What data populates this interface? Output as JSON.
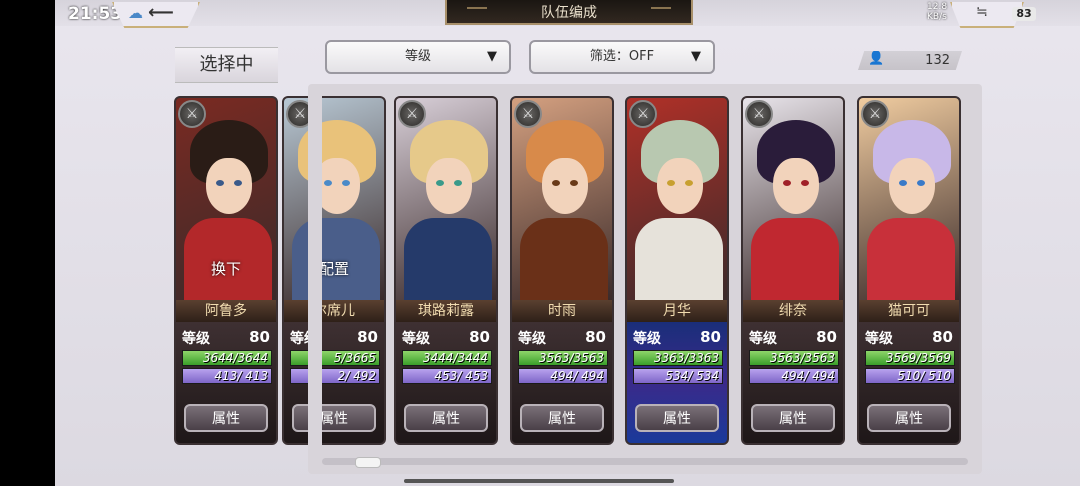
{
  "status": {
    "time": "21:53",
    "net_speed": "12.8\nKB/s",
    "battery": "83"
  },
  "header": {
    "title": "队伍编成",
    "back_glyph": "⟵",
    "menu_glyph": "≒"
  },
  "left": {
    "selected_label": "选择中"
  },
  "filters": {
    "sort_label": "等级",
    "filter_label": "筛选：OFF"
  },
  "roster": {
    "count": "132"
  },
  "labels": {
    "level": "等级",
    "attribute_button": "属性"
  },
  "cards": [
    {
      "name": "阿鲁多",
      "level": "80",
      "hp": "3644/3644",
      "mp": "413/ 413",
      "overlay": "换下",
      "colors": {
        "bg": "#7a2a22",
        "hair": "#2a1c16",
        "outfit": "#b3282a",
        "eye": "#3a5a8a"
      }
    },
    {
      "name": "尔席儿",
      "level": "80",
      "hp": "5/3665",
      "mp": "2/ 492",
      "overlay": "配置",
      "colors": {
        "bg": "#b8c8d4",
        "hair": "#e9c27a",
        "outfit": "#4a5e8a",
        "eye": "#4a8ac8"
      }
    },
    {
      "name": "琪路莉露",
      "level": "80",
      "hp": "3444/3444",
      "mp": "453/ 453",
      "overlay": "",
      "colors": {
        "bg": "#d8cfd8",
        "hair": "#e6c98a",
        "outfit": "#253a6a",
        "eye": "#3a9a8a"
      }
    },
    {
      "name": "时雨",
      "level": "80",
      "hp": "3563/3563",
      "mp": "494/ 494",
      "overlay": "",
      "colors": {
        "bg": "#d4a080",
        "hair": "#d88a4a",
        "outfit": "#6a3018",
        "eye": "#6a3a18"
      }
    },
    {
      "name": "月华",
      "level": "80",
      "hp": "3363/3363",
      "mp": "534/ 534",
      "overlay": "",
      "colors": {
        "bg": "#b03028",
        "hair": "#b8c8b0",
        "outfit": "#e6e2da",
        "eye": "#c8a030"
      }
    },
    {
      "name": "绯奈",
      "level": "80",
      "hp": "3563/3563",
      "mp": "494/ 494",
      "overlay": "",
      "colors": {
        "bg": "#e8e4ea",
        "hair": "#2a1c3a",
        "outfit": "#c02830",
        "eye": "#a02028"
      }
    },
    {
      "name": "猫可可",
      "level": "80",
      "hp": "3569/3569",
      "mp": "510/ 510",
      "overlay": "",
      "colors": {
        "bg": "#f0cca0",
        "hair": "#c8b8e8",
        "outfit": "#c8303a",
        "eye": "#3a7ac8"
      }
    }
  ]
}
